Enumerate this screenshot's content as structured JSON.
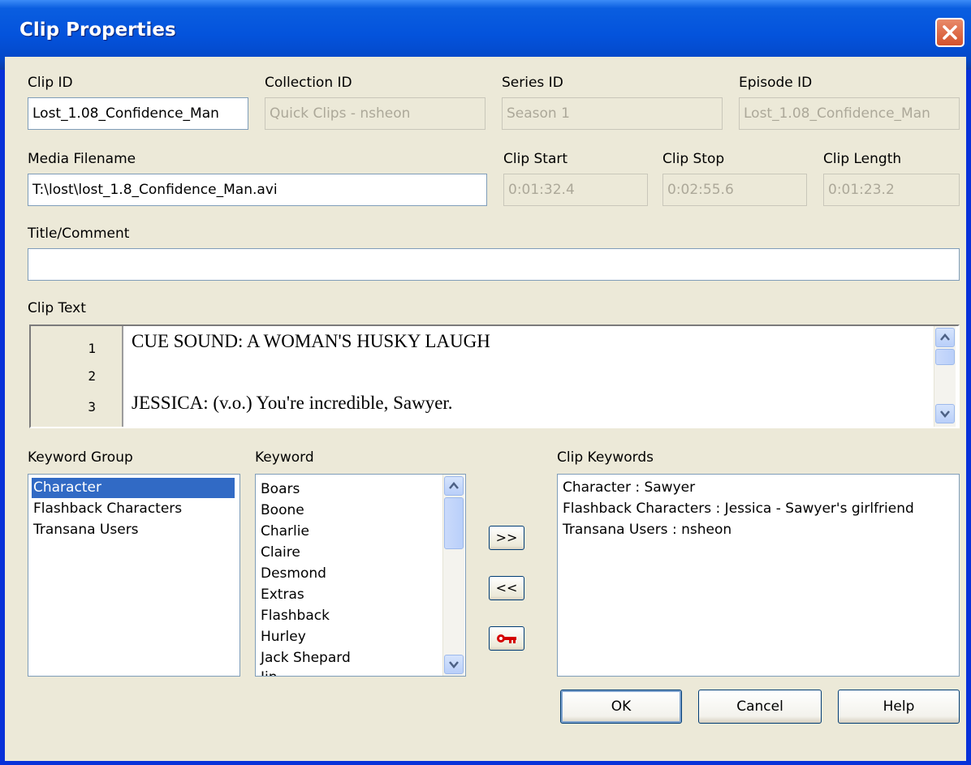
{
  "window": {
    "title": "Clip Properties"
  },
  "fields": {
    "clip_id": {
      "label": "Clip ID",
      "value": "Lost_1.08_Confidence_Man"
    },
    "collection_id": {
      "label": "Collection ID",
      "value": "Quick Clips - nsheon"
    },
    "series_id": {
      "label": "Series ID",
      "value": "Season 1"
    },
    "episode_id": {
      "label": "Episode ID",
      "value": "Lost_1.08_Confidence_Man"
    },
    "media_filename": {
      "label": "Media Filename",
      "value": "T:\\lost\\lost_1.8_Confidence_Man.avi"
    },
    "clip_start": {
      "label": "Clip Start",
      "value": "0:01:32.4"
    },
    "clip_stop": {
      "label": "Clip Stop",
      "value": "0:02:55.6"
    },
    "clip_length": {
      "label": "Clip Length",
      "value": "0:01:23.2"
    },
    "title_comment": {
      "label": "Title/Comment",
      "value": ""
    }
  },
  "clip_text": {
    "label": "Clip Text",
    "lines": [
      {
        "num": "1",
        "text": "CUE SOUND:  A WOMAN'S HUSKY LAUGH"
      },
      {
        "num": "2",
        "text": ""
      },
      {
        "num": "3",
        "text": "JESSICA:  (v.o.)  You're incredible, Sawyer."
      }
    ]
  },
  "keyword_group": {
    "label": "Keyword Group",
    "items": [
      "Character",
      "Flashback Characters",
      "Transana Users"
    ],
    "selected": "Character"
  },
  "keyword": {
    "label": "Keyword",
    "items": [
      "Boars",
      "Boone",
      "Charlie",
      "Claire",
      "Desmond",
      "Extras",
      "Flashback",
      "Hurley",
      "Jack Shepard",
      "Jin"
    ]
  },
  "clip_keywords": {
    "label": "Clip Keywords",
    "items": [
      "Character : Sawyer",
      "Flashback Characters : Jessica - Sawyer's girlfriend",
      "Transana Users : nsheon"
    ]
  },
  "transfer_buttons": {
    "add": ">>",
    "remove": "<<",
    "key_icon": "key-icon"
  },
  "buttons": {
    "ok": "OK",
    "cancel": "Cancel",
    "help": "Help"
  },
  "colors": {
    "titlebar": "#0453dc",
    "selection": "#316ac5",
    "dialog_bg": "#ece9d8",
    "key": "#d40000"
  }
}
